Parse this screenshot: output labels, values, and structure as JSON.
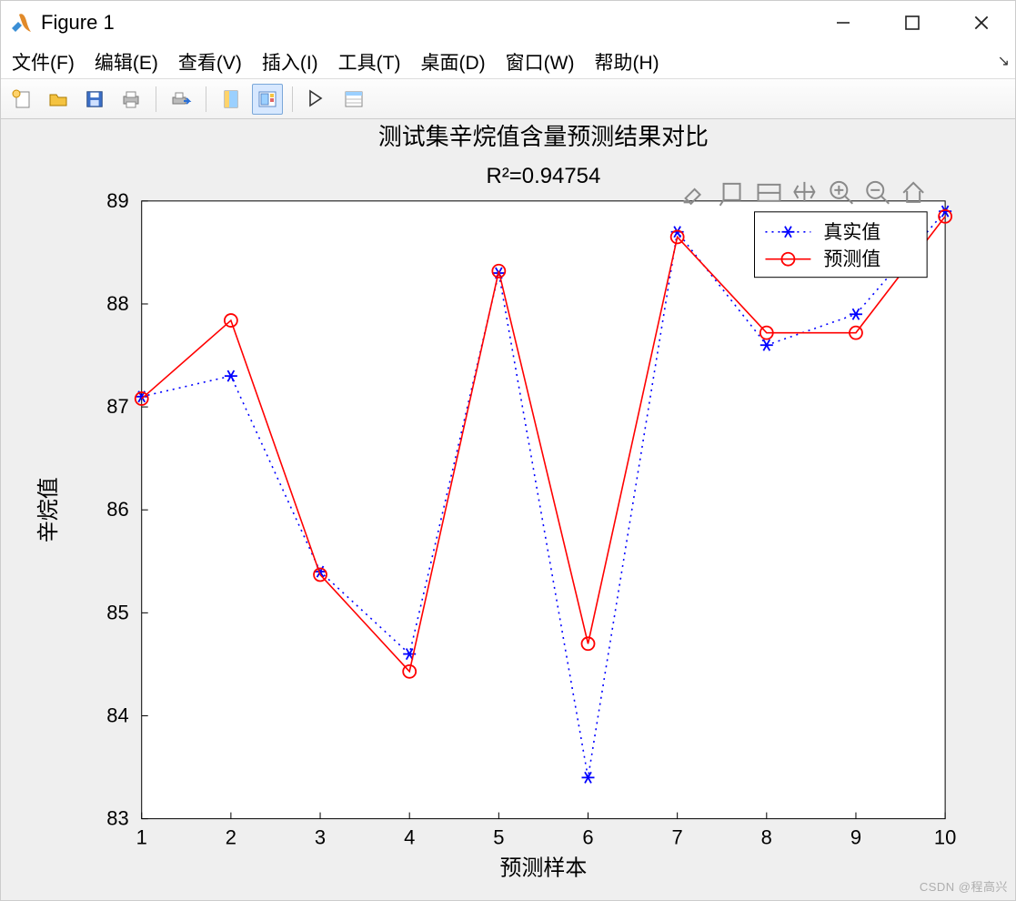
{
  "window": {
    "title": "Figure 1"
  },
  "menu": {
    "file": "文件(F)",
    "edit": "编辑(E)",
    "view": "查看(V)",
    "insert": "插入(I)",
    "tools": "工具(T)",
    "desktop": "桌面(D)",
    "window": "窗口(W)",
    "help": "帮助(H)"
  },
  "legend": {
    "true_label": "真实值",
    "pred_label": "预测值"
  },
  "watermark": "CSDN @程高兴",
  "chart_data": {
    "type": "line",
    "title": "测试集辛烷值含量预测结果对比",
    "subtitle": "R²=0.94754",
    "xlabel": "预测样本",
    "ylabel": "辛烷值",
    "x": [
      1,
      2,
      3,
      4,
      5,
      6,
      7,
      8,
      9,
      10
    ],
    "xticks": [
      1,
      2,
      3,
      4,
      5,
      6,
      7,
      8,
      9,
      10
    ],
    "yticks": [
      83,
      84,
      85,
      86,
      87,
      88,
      89
    ],
    "xlim": [
      1,
      10
    ],
    "ylim": [
      83,
      89
    ],
    "series": [
      {
        "name": "真实值",
        "color": "#0000ff",
        "marker": "star",
        "style": "dotted",
        "values": [
          87.1,
          87.3,
          85.4,
          84.6,
          88.3,
          83.4,
          88.7,
          87.6,
          87.9,
          88.9
        ]
      },
      {
        "name": "预测值",
        "color": "#ff0000",
        "marker": "circle",
        "style": "solid",
        "values": [
          87.08,
          87.84,
          85.37,
          84.43,
          88.32,
          84.7,
          88.65,
          87.72,
          87.72,
          88.85
        ]
      }
    ],
    "legend_pos": "northeast"
  }
}
